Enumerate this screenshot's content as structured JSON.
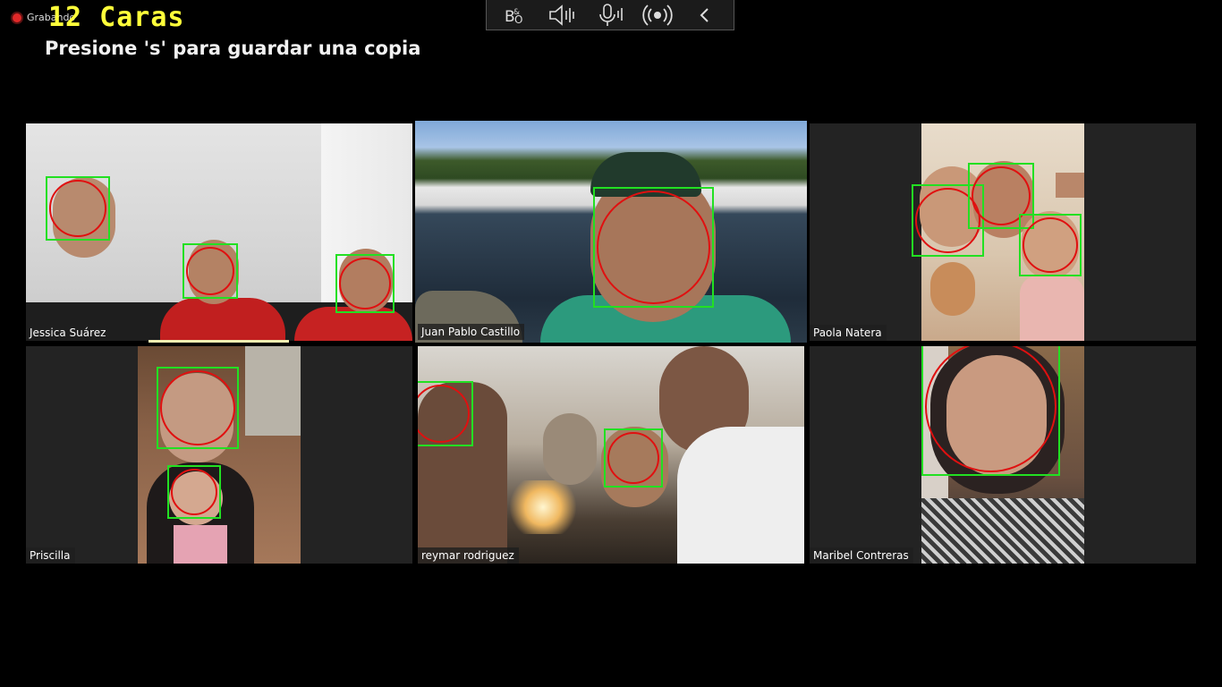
{
  "recording": {
    "label": "Grabando"
  },
  "overlay": {
    "title": "12 Caras",
    "subtitle": "Presione 's' para guardar una copia"
  },
  "toolbar": {
    "icons": [
      "bo-logo-icon",
      "speaker-icon",
      "microphone-icon",
      "broadcast-icon",
      "chevron-left-icon"
    ]
  },
  "participants": [
    {
      "name": "Jessica Suárez"
    },
    {
      "name": "Juan Pablo Castillo"
    },
    {
      "name": "Paola Natera"
    },
    {
      "name": "Priscilla"
    },
    {
      "name": "reymar rodriguez"
    },
    {
      "name": "Maribel Contreras"
    }
  ],
  "colors": {
    "face_box": "#22e022",
    "face_circle": "#e01010",
    "active_speaker": "#d9e58a",
    "title": "#ffff3a"
  }
}
